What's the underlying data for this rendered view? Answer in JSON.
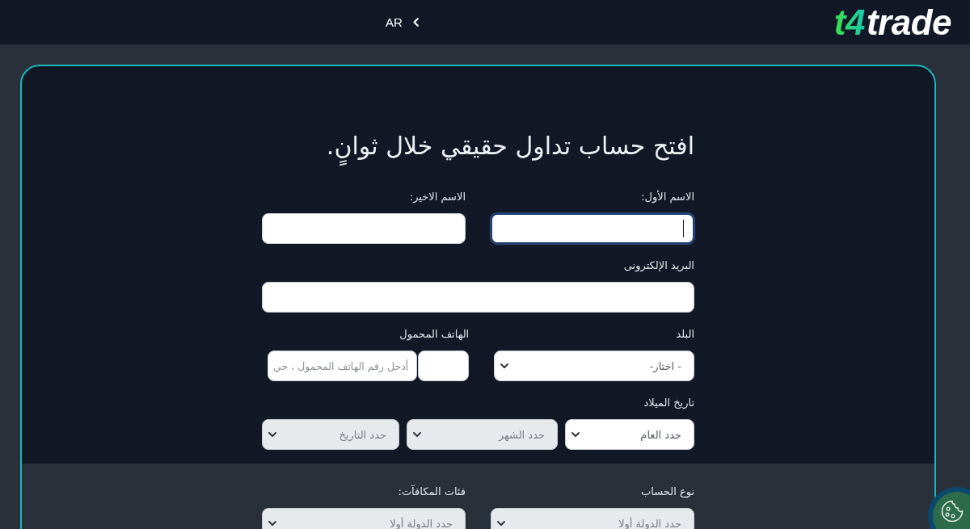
{
  "header": {
    "logo": {
      "mark": "t4",
      "name": "trade"
    },
    "language": "AR"
  },
  "form": {
    "sections": [
      {
        "kind": "dark",
        "title": "افتح حساب تداول حقيقي خلال ثوانٍ.",
        "rows": [
          {
            "groups": [
              {
                "label": "الاسم الأول:",
                "controls": [
                  {
                    "kind": "input",
                    "focused": true,
                    "disabled": false
                  }
                ]
              },
              {
                "label": "الاسم الاخير:",
                "controls": [
                  {
                    "kind": "input",
                    "focused": false,
                    "disabled": false
                  }
                ]
              }
            ]
          },
          {
            "groups": [
              {
                "label": "البريد الإلكترونى",
                "controls": [
                  {
                    "kind": "input",
                    "focused": false,
                    "disabled": false
                  }
                ]
              }
            ]
          },
          {
            "groups": [
              {
                "label": "البلد",
                "controls": [
                  {
                    "kind": "select",
                    "value": "- اختار-",
                    "focused": false,
                    "disabled": false
                  }
                ]
              },
              {
                "label": "الهاتف المحمول",
                "controls": [
                  {
                    "kind": "input",
                    "focused": false,
                    "disabled": false
                  },
                  {
                    "kind": "input",
                    "placeholder": "أدخل رقم الهاتف المحمول ، حي",
                    "focused": false,
                    "disabled": false
                  }
                ]
              }
            ]
          },
          {
            "groups": [
              {
                "label": "تاريخ الميلاد",
                "controls": [
                  {
                    "kind": "select",
                    "value": "حدد العام",
                    "focused": false,
                    "disabled": false
                  },
                  {
                    "kind": "select",
                    "value": "حدد الشهر",
                    "focused": false,
                    "disabled": true
                  },
                  {
                    "kind": "select",
                    "value": "حدد التاريخ",
                    "focused": false,
                    "disabled": true
                  }
                ]
              }
            ]
          }
        ]
      },
      {
        "kind": "light",
        "rows": [
          {
            "groups": [
              {
                "label": "نوع الحساب",
                "controls": [
                  {
                    "kind": "select",
                    "value": "حدد الدولة أولا",
                    "focused": false,
                    "disabled": true
                  }
                ]
              },
              {
                "label": "فئات المكافآت:",
                "controls": [
                  {
                    "kind": "select",
                    "value": "حدد الدولة أولا",
                    "focused": false,
                    "disabled": true
                  }
                ]
              }
            ]
          }
        ]
      }
    ]
  }
}
